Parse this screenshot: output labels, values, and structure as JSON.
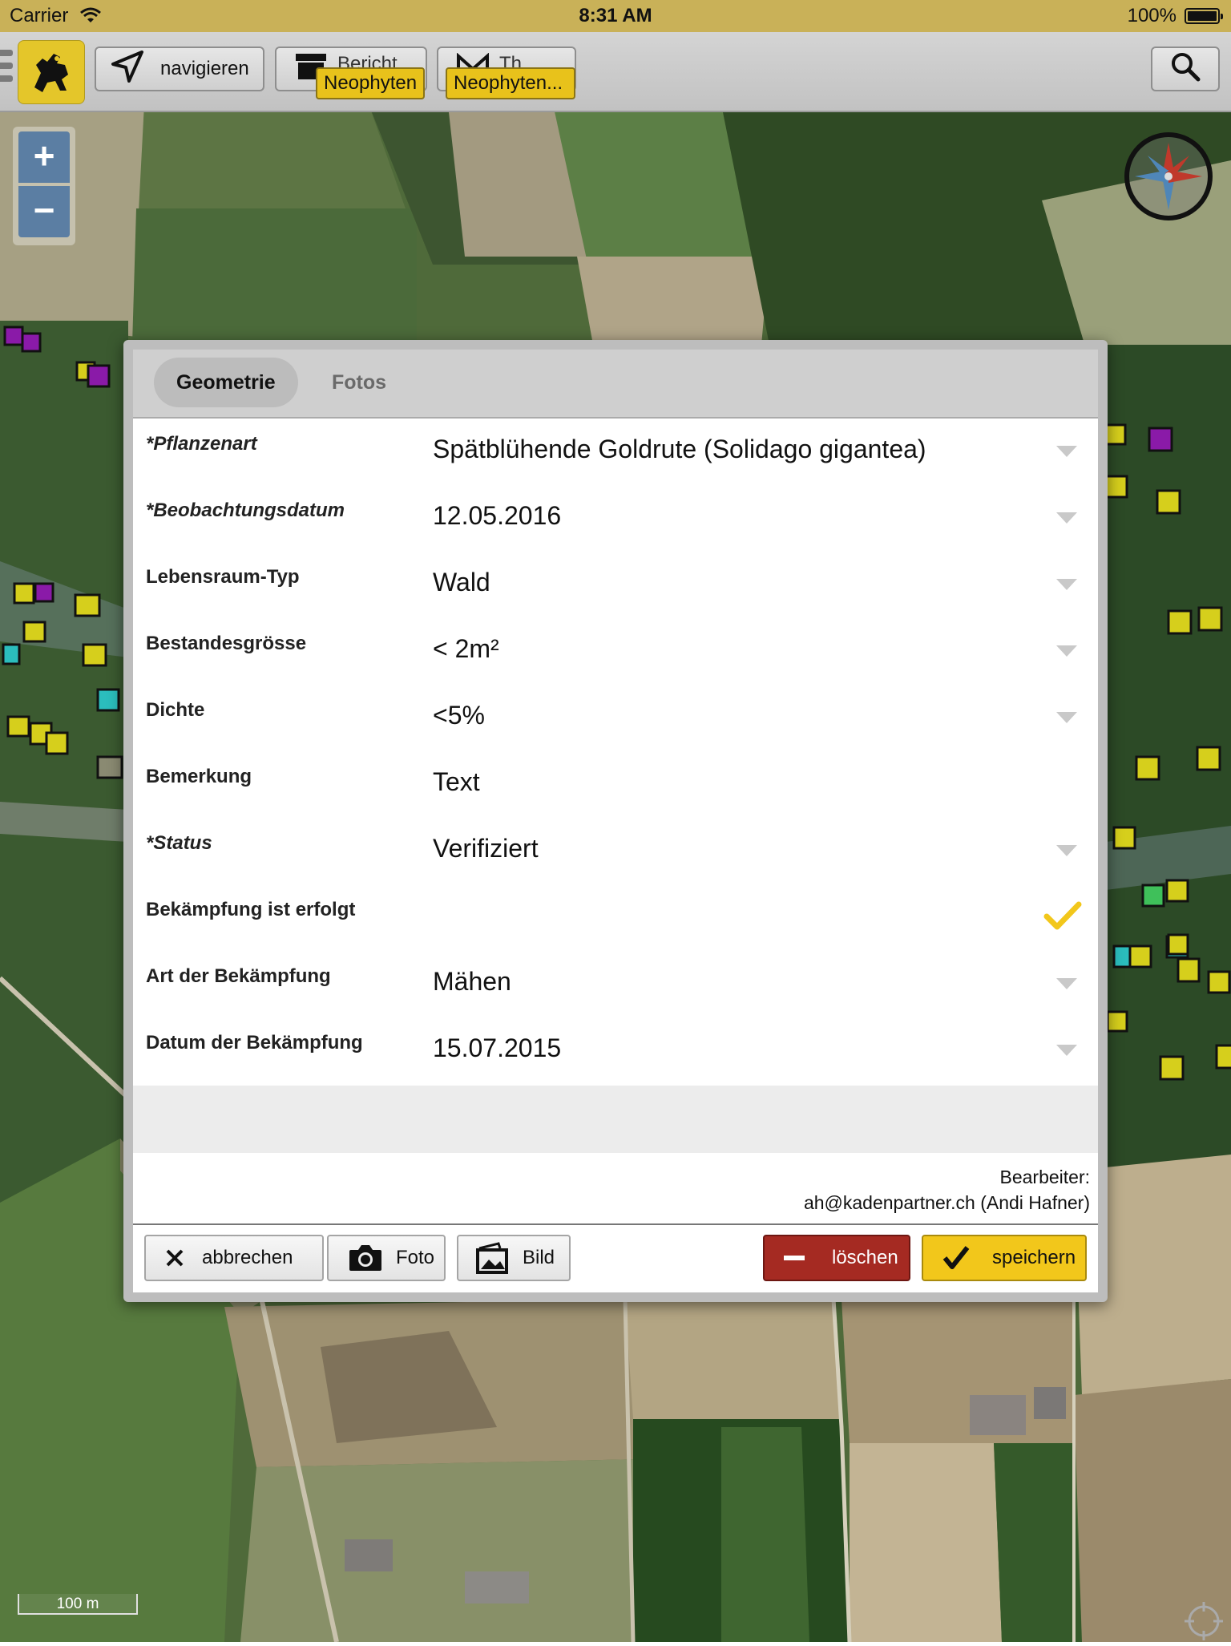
{
  "status_bar": {
    "carrier": "Carrier",
    "time": "8:31 AM",
    "battery": "100%"
  },
  "toolbar": {
    "navigate_label": "navigieren",
    "report_label_behind": "Bericht",
    "theme_label_behind": "Th",
    "chip_neophyten": "Neophyten",
    "chip_neophyten_more": "Neophyten...",
    "icons": [
      "menu-icon",
      "logo",
      "navigate-arrow-icon",
      "archive-icon",
      "mail-icon",
      "search-icon"
    ]
  },
  "map": {
    "zoom_in": "+",
    "zoom_out": "−",
    "scale": "100 m"
  },
  "dialog": {
    "tabs": [
      {
        "label": "Geometrie",
        "active": true
      },
      {
        "label": "Fotos",
        "active": false
      }
    ],
    "fields": [
      {
        "label": "*Pflanzenart",
        "value": "Spätblühende Goldrute (Solidago gigantea)",
        "dropdown": true,
        "required": true
      },
      {
        "label": "*Beobachtungsdatum",
        "value": "12.05.2016",
        "dropdown": true,
        "required": true
      },
      {
        "label": "Lebensraum-Typ",
        "value": "Wald",
        "dropdown": true,
        "required": false
      },
      {
        "label": "Bestandesgrösse",
        "value": "< 2m²",
        "dropdown": true,
        "required": false
      },
      {
        "label": "Dichte",
        "value": "<5%",
        "dropdown": true,
        "required": false
      },
      {
        "label": "Bemerkung",
        "value": "Text",
        "dropdown": false,
        "required": false
      },
      {
        "label": "*Status",
        "value": "Verifiziert",
        "dropdown": true,
        "required": true
      },
      {
        "label": "Bekämpfung ist erfolgt",
        "value": "",
        "dropdown": false,
        "required": false,
        "checked": true
      },
      {
        "label": "Art der Bekämpfung",
        "value": "Mähen",
        "dropdown": true,
        "required": false
      },
      {
        "label": "Datum der Bekämpfung",
        "value": "15.07.2015",
        "dropdown": true,
        "required": false
      }
    ],
    "editor_label": "Bearbeiter:",
    "editor_value": "ah@kadenpartner.ch (Andi Hafner)",
    "buttons": {
      "cancel": "abbrechen",
      "photo": "Foto",
      "image": "Bild",
      "delete": "löschen",
      "save": "speichern"
    }
  },
  "colors": {
    "status_bar": "#c9b158",
    "accent_yellow": "#f2c71b",
    "delete_red": "#a52a22",
    "zoom_blue": "#5b7ea3",
    "check_yellow": "#f2c71b"
  }
}
